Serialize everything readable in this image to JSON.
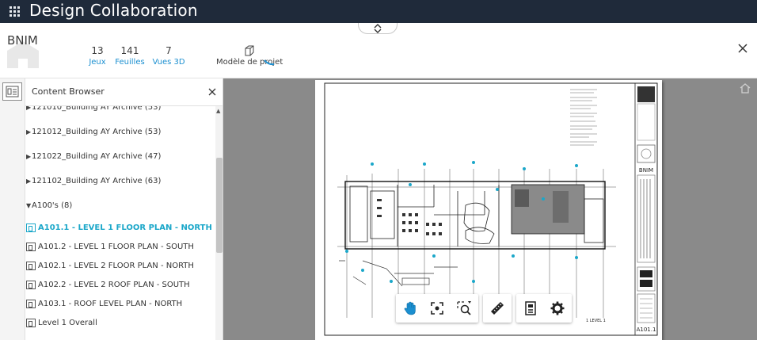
{
  "app": {
    "title": "Design Collaboration"
  },
  "project": {
    "name": "BNIM",
    "stats": [
      {
        "value": "13",
        "label": "Jeux"
      },
      {
        "value": "141",
        "label": "Feuilles"
      },
      {
        "value": "7",
        "label": "Vues 3D"
      }
    ],
    "model_label": "Modèle de projet"
  },
  "browser": {
    "title": "Content Browser",
    "items": [
      {
        "type": "folder",
        "label": "121010_Building AY Archive (53)",
        "expanded": false
      },
      {
        "type": "folder",
        "label": "121012_Building AY Archive (53)",
        "expanded": false
      },
      {
        "type": "folder",
        "label": "121022_Building AY Archive (47)",
        "expanded": false
      },
      {
        "type": "folder",
        "label": "121102_Building AY Archive (63)",
        "expanded": false
      },
      {
        "type": "folder",
        "label": "A100's (8)",
        "expanded": true
      },
      {
        "type": "sheet",
        "label": "A101.1 - LEVEL 1 FLOOR PLAN - NORTH",
        "active": true
      },
      {
        "type": "sheet",
        "label": "A101.2 - LEVEL 1 FLOOR PLAN - SOUTH",
        "active": false
      },
      {
        "type": "sheet",
        "label": "A102.1 - LEVEL 2 FLOOR PLAN - NORTH",
        "active": false
      },
      {
        "type": "sheet",
        "label": "A102.2 - LEVEL 2 ROOF PLAN - SOUTH",
        "active": false
      },
      {
        "type": "sheet",
        "label": "A103.1 - ROOF LEVEL PLAN - NORTH",
        "active": false
      },
      {
        "type": "sheet",
        "label": "Level 1 Overall",
        "active": false
      }
    ]
  },
  "sheet": {
    "title_block_name": "BNIM",
    "sheet_number": "A101.1",
    "scale_note": "1 LEVEL 1"
  },
  "toolbar": {
    "tools": [
      "pan-icon",
      "fit-view-icon",
      "zoom-window-icon",
      "measure-icon",
      "sheet-properties-icon",
      "settings-icon"
    ]
  },
  "colors": {
    "topbar": "#1f2a3a",
    "accent": "#1ba7c9",
    "link": "#1b8fd0",
    "viewer_bg": "#8a8a8a"
  }
}
